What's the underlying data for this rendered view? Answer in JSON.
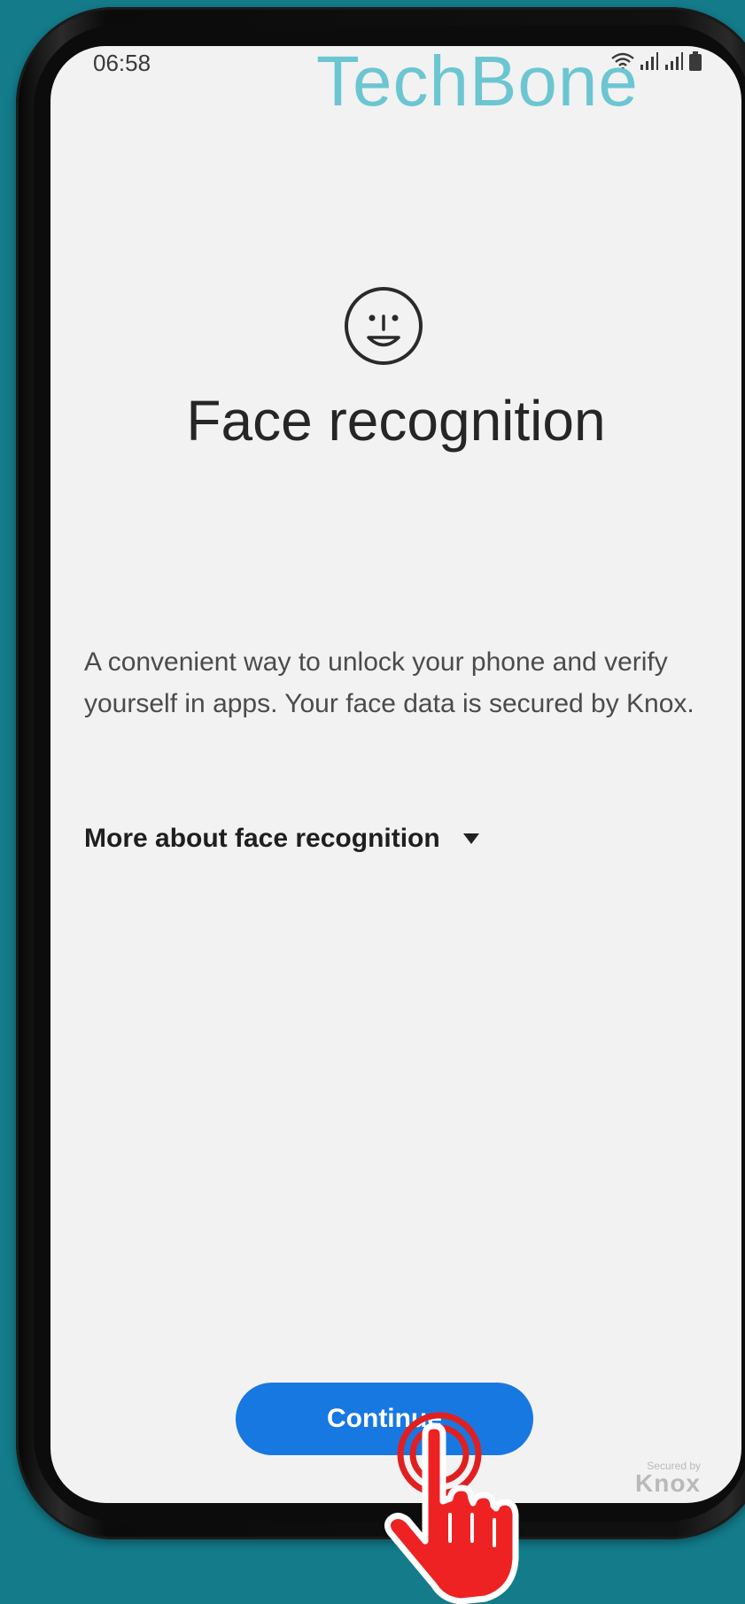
{
  "status_bar": {
    "time": "06:58",
    "icons": [
      "wifi-icon",
      "signal-icon",
      "signal-icon",
      "battery-icon"
    ]
  },
  "watermark": "TechBone",
  "header": {
    "icon": "face-smile-icon",
    "title": "Face recognition"
  },
  "body": {
    "description": "A convenient way to unlock your phone and verify yourself in apps. Your face data is secured by Knox.",
    "more_label": "More about face recognition",
    "more_icon": "triangle-down-icon"
  },
  "footer": {
    "continue_label": "Continue",
    "knox_small": "Secured by",
    "knox_big": "Knox"
  },
  "colors": {
    "background": "#137b8a",
    "screen": "#f2f2f2",
    "accent": "#1878e2",
    "tap_hand": "#ee2222",
    "watermark": "#6cc6d2"
  }
}
